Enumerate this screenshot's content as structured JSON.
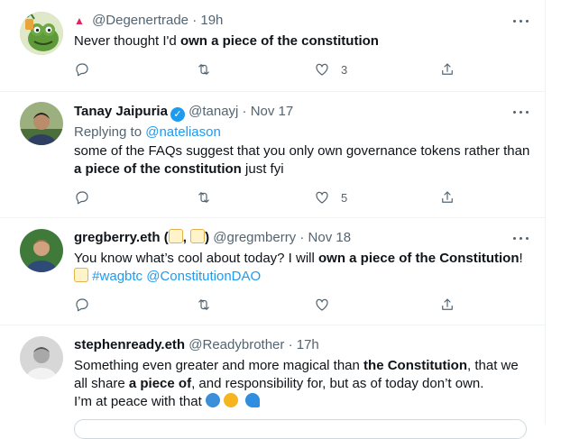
{
  "tweets": [
    {
      "name": "",
      "handle": "@Degenertrade",
      "time": "19h",
      "body_plain": "Never thought I'd ",
      "body_bold": "own a piece of the constitution",
      "likes": "3"
    },
    {
      "name": "Tanay Jaipuria",
      "handle": "@tanayj",
      "time": "Nov 17",
      "reply_prefix": "Replying to ",
      "reply_to": "@nateliason",
      "body_plain": "some of the FAQs suggest that you only own governance tokens rather than",
      "body_bold": "a piece of the constitution",
      "body_tail": " just fyi",
      "likes": "5"
    },
    {
      "name_prefix": "gregberry.eth (",
      "name_sep": ", ",
      "name_suffix": ")",
      "handle": "@gregmberry",
      "time": "Nov 18",
      "body_plain": "You know what’s cool about today? I will ",
      "body_bold": "own a piece of the Constitution",
      "body_tail": "!",
      "hashtag": "#wagbtc",
      "mention": "@ConstitutionDAO"
    },
    {
      "name": "stephenready.eth",
      "handle": "@Readybrother",
      "time": "17h",
      "line1_plain": "Something even greater and more magical than ",
      "line1_bold": "the Constitution",
      "line1_tail": ", that we",
      "line2_plain": "all share ",
      "line2_bold": "a piece of",
      "line2_tail": ", and responsibility for, but as of today don’t own.",
      "line3": "I’m at peace with that"
    }
  ],
  "separator": "·",
  "icons": [
    "reply-icon",
    "retweet-icon",
    "like-icon",
    "share-icon",
    "more-icon",
    "verified-badge-icon",
    "scroll-emoji",
    "earth-emoji",
    "sun-emoji",
    "wave-emoji"
  ]
}
